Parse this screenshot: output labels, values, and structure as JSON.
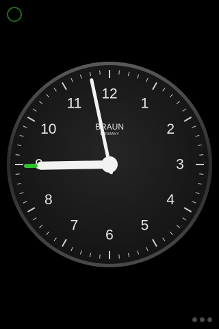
{
  "clock": {
    "numerals": [
      "12",
      "1",
      "2",
      "3",
      "4",
      "5",
      "6",
      "7",
      "8",
      "9",
      "10",
      "11"
    ],
    "brand": {
      "name": "BRAUN",
      "origin": "GERMANY"
    },
    "time": {
      "hour": 8,
      "minute": 58
    },
    "colors": {
      "face": "#1c1c1c",
      "bezel": "#3a3a3a",
      "marks": "#cfcfcf",
      "hands": "#f2f2f2",
      "accent": "#2ec12e"
    }
  },
  "pager": {
    "page_count": 3,
    "active_page": 1
  }
}
